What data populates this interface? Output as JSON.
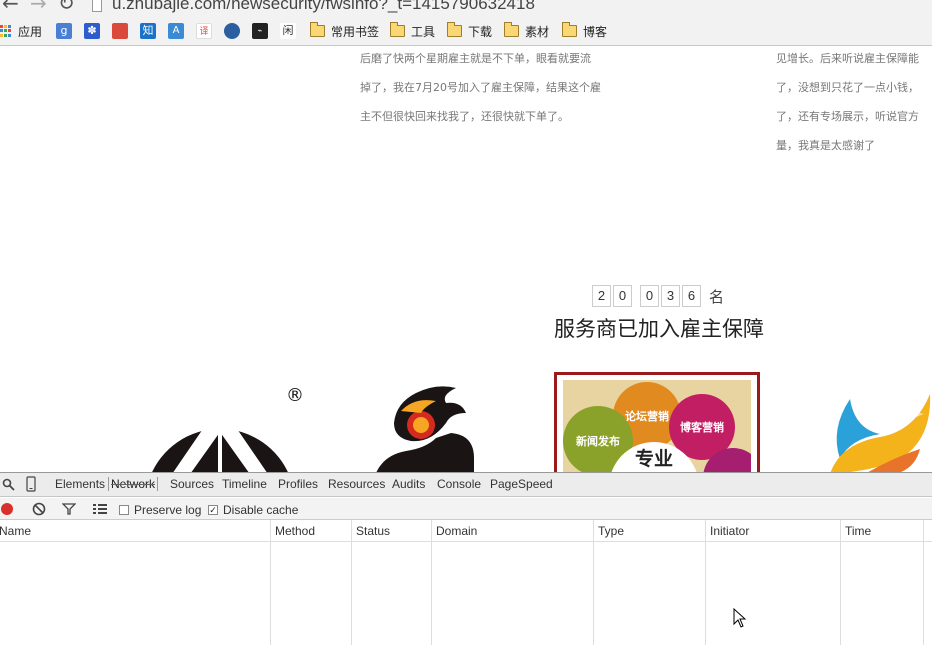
{
  "browser": {
    "url": "u.zhubajie.com/newsecurity/fwsinfo?_t=1415790632418",
    "bookmarks": [
      {
        "label": "应用",
        "icon": "apps-grid-icon"
      },
      {
        "label": "",
        "icon": "google-icon",
        "color": "#4a7fd6"
      },
      {
        "label": "",
        "icon": "baidu-paw-icon",
        "color": "#2e5ccc"
      },
      {
        "label": "",
        "icon": "news-icon",
        "color": "#d94a3a"
      },
      {
        "label": "知",
        "icon": "zhihu-icon",
        "color": "#1a73c9"
      },
      {
        "label": "",
        "icon": "translate-icon",
        "color": "#3a8ad6"
      },
      {
        "label": "译",
        "icon": "youdao-icon",
        "color": "#e04a3a"
      },
      {
        "label": "",
        "icon": "globe-icon",
        "color": "#2b5fa0"
      },
      {
        "label": "",
        "icon": "dark-site-icon",
        "color": "#222222"
      },
      {
        "label": "闲",
        "icon": "xian-icon",
        "color": "#333333"
      },
      {
        "label": "常用书签",
        "icon": "folder-icon"
      },
      {
        "label": "工具",
        "icon": "folder-icon"
      },
      {
        "label": "下载",
        "icon": "folder-icon"
      },
      {
        "label": "素材",
        "icon": "folder-icon"
      },
      {
        "label": "博客",
        "icon": "folder-icon"
      }
    ]
  },
  "page": {
    "testimonial_left": [
      "后磨了快两个星期雇主就是不下单，眼看就要流",
      "掉了，我在7月20号加入了雇主保障，结果这个雇",
      "主不但很快回来找我了，还很快就下单了。"
    ],
    "testimonial_right": [
      "见增长。后来听说雇主保障能",
      "了，没想到只花了一点小钱，",
      "了，还有专场展示，听说官方",
      "量，我真是太感谢了"
    ],
    "counter": {
      "digits": [
        "2",
        "0",
        "0",
        "3",
        "6"
      ],
      "unit": "名",
      "headline": "服务商已加入雇主保障"
    },
    "logos": {
      "registered_mark": "®",
      "card_bubbles": [
        "论坛营销",
        "博客营销",
        "新闻发布"
      ],
      "card_center": "专业"
    }
  },
  "devtools": {
    "tabs": [
      "Elements",
      "Network",
      "Sources",
      "Timeline",
      "Profiles",
      "Resources",
      "Audits",
      "Console",
      "PageSpeed"
    ],
    "active_tab": "Network",
    "preserve_log": {
      "label": "Preserve log",
      "checked": false
    },
    "disable_cache": {
      "label": "Disable cache",
      "checked": true
    },
    "columns": [
      "Name",
      "Method",
      "Status",
      "Domain",
      "Type",
      "Initiator",
      "Time"
    ],
    "colors": {
      "record": "#d9302c",
      "accent_card_border": "#9a1b1b"
    }
  }
}
